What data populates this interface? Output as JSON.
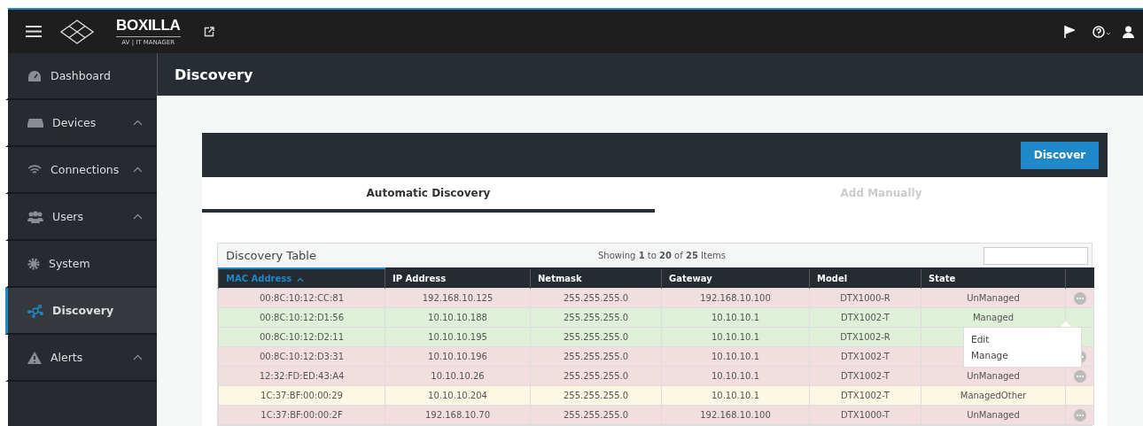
{
  "header": {
    "brand": "BOXILLA",
    "tagline": "AV | IT MANAGER"
  },
  "sidebar": {
    "items": [
      {
        "label": "Dashboard",
        "kind": "dashboard",
        "expandable": false,
        "selected": false
      },
      {
        "label": "Devices",
        "kind": "devices",
        "expandable": true,
        "selected": false
      },
      {
        "label": "Connections",
        "kind": "wifi",
        "expandable": true,
        "selected": false
      },
      {
        "label": "Users",
        "kind": "users",
        "expandable": true,
        "selected": false
      },
      {
        "label": "System",
        "kind": "gear",
        "expandable": false,
        "selected": false
      },
      {
        "label": "Discovery",
        "kind": "network",
        "expandable": false,
        "selected": true
      },
      {
        "label": "Alerts",
        "kind": "alert",
        "expandable": true,
        "selected": false
      }
    ]
  },
  "page": {
    "title": "Discovery"
  },
  "card": {
    "button": "Discover",
    "tabs": [
      {
        "label": "Automatic Discovery",
        "selected": true
      },
      {
        "label": "Add Manually",
        "selected": false
      }
    ]
  },
  "table": {
    "title": "Discovery Table",
    "summary": "Showing **1** to **20** of **25** Items",
    "columns": [
      {
        "label": "MAC Address",
        "sorted": true
      },
      {
        "label": "IP Address",
        "sorted": false
      },
      {
        "label": "Netmask",
        "sorted": false
      },
      {
        "label": "Gateway",
        "sorted": false
      },
      {
        "label": "Model",
        "sorted": false
      },
      {
        "label": "State",
        "sorted": false
      }
    ],
    "rows": [
      {
        "cells": [
          "00:8C:10:12:CC:81",
          "192.168.10.125",
          "255.255.255.0",
          "192.168.10.100",
          "DTX1000-R",
          "UnManaged"
        ],
        "color": "#f2dede",
        "menu": true
      },
      {
        "cells": [
          "00:8C:10:12:D1:56",
          "10.10.10.188",
          "255.255.255.0",
          "10.10.10.1",
          "DTX1002-T",
          "Managed"
        ],
        "color": "#dff0d8",
        "menu": false
      },
      {
        "cells": [
          "00:8C:10:12:D2:11",
          "10.10.10.195",
          "255.255.255.0",
          "10.10.10.1",
          "DTX1002-R",
          ""
        ],
        "color": "#dff0d8",
        "menu": false
      },
      {
        "cells": [
          "00:8C:10:12:D3:31",
          "10.10.10.196",
          "255.255.255.0",
          "10.10.10.1",
          "DTX1002-T",
          ""
        ],
        "color": "#f2dede",
        "menu": true
      },
      {
        "cells": [
          "12:32:FD:ED:43:A4",
          "10.10.10.26",
          "255.255.255.0",
          "10.10.10.1",
          "DTX1002-T",
          "UnManaged"
        ],
        "color": "#f2dede",
        "menu": true
      },
      {
        "cells": [
          "1C:37:BF:00:00:29",
          "10.10.10.204",
          "255.255.255.0",
          "10.10.10.1",
          "DTX1002-T",
          "ManagedOther"
        ],
        "color": "#fcf8e3",
        "menu": false
      },
      {
        "cells": [
          "1C:37:BF:00:00:2F",
          "192.168.10.70",
          "255.255.255.0",
          "192.168.10.100",
          "DTX1000-T",
          "UnManaged"
        ],
        "color": "#f2dede",
        "menu": true
      }
    ],
    "menu": {
      "items": [
        "Edit",
        "Manage"
      ]
    }
  }
}
